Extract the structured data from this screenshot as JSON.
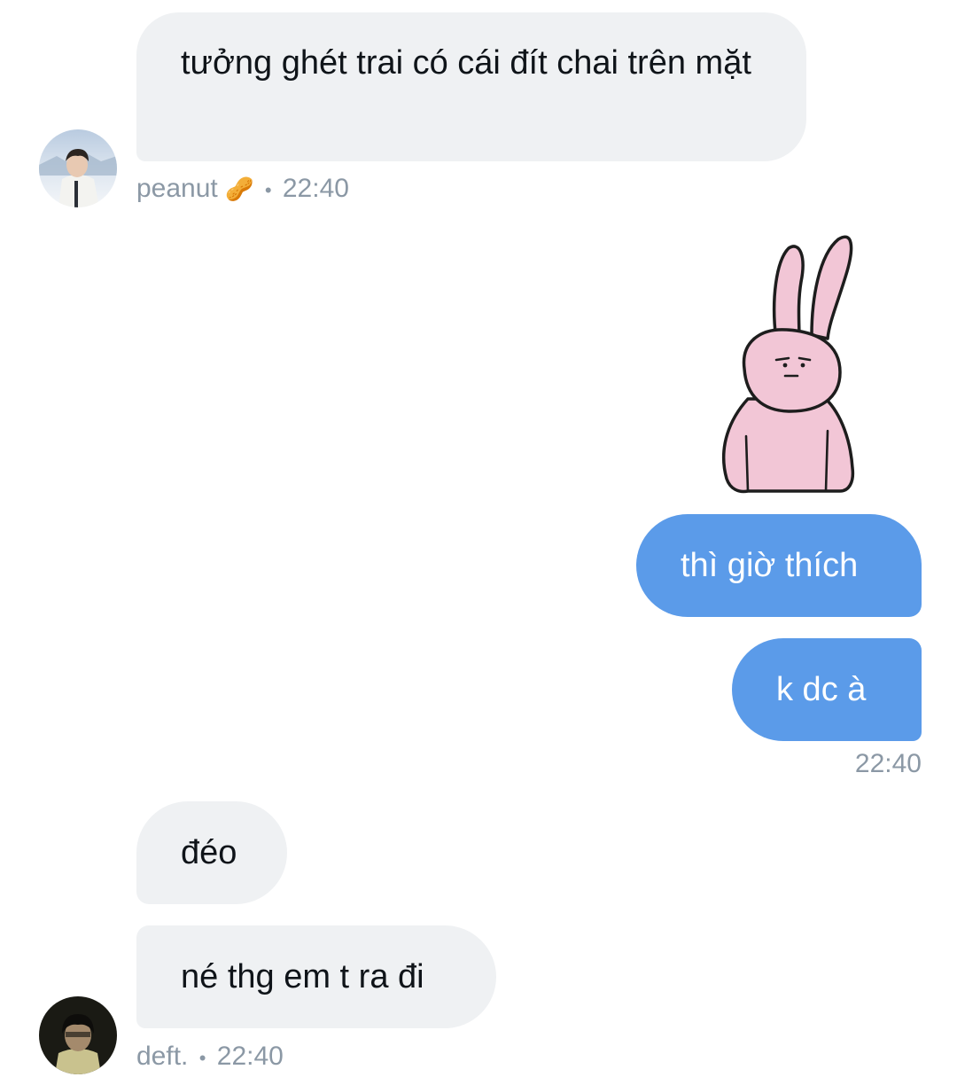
{
  "messages": [
    {
      "text": "tưởng ghét trai có cái đít chai trên mặt",
      "sender": "peanut",
      "direction": "incoming"
    },
    {
      "sender": "me",
      "direction": "outgoing",
      "type": "sticker",
      "sticker": "pink-bunny-sticker"
    },
    {
      "text": "thì giờ thích",
      "sender": "me",
      "direction": "outgoing"
    },
    {
      "text": "k dc à",
      "sender": "me",
      "direction": "outgoing"
    },
    {
      "text": "đéo",
      "sender": "deft.",
      "direction": "incoming"
    },
    {
      "text": "né thg em t ra đi",
      "sender": "deft.",
      "direction": "incoming"
    }
  ],
  "meta": {
    "peanut": {
      "name": "peanut",
      "emoji": "🥜",
      "separator": "•",
      "time": "22:40"
    },
    "me": {
      "time": "22:40"
    },
    "deft": {
      "name": "deft.",
      "separator": "•",
      "time": "22:40"
    }
  },
  "colors": {
    "incoming_bubble": "#eff1f3",
    "outgoing_bubble": "#5b9be9",
    "meta_text": "#8b98a5",
    "sticker_pink": "#f2c6d6"
  }
}
